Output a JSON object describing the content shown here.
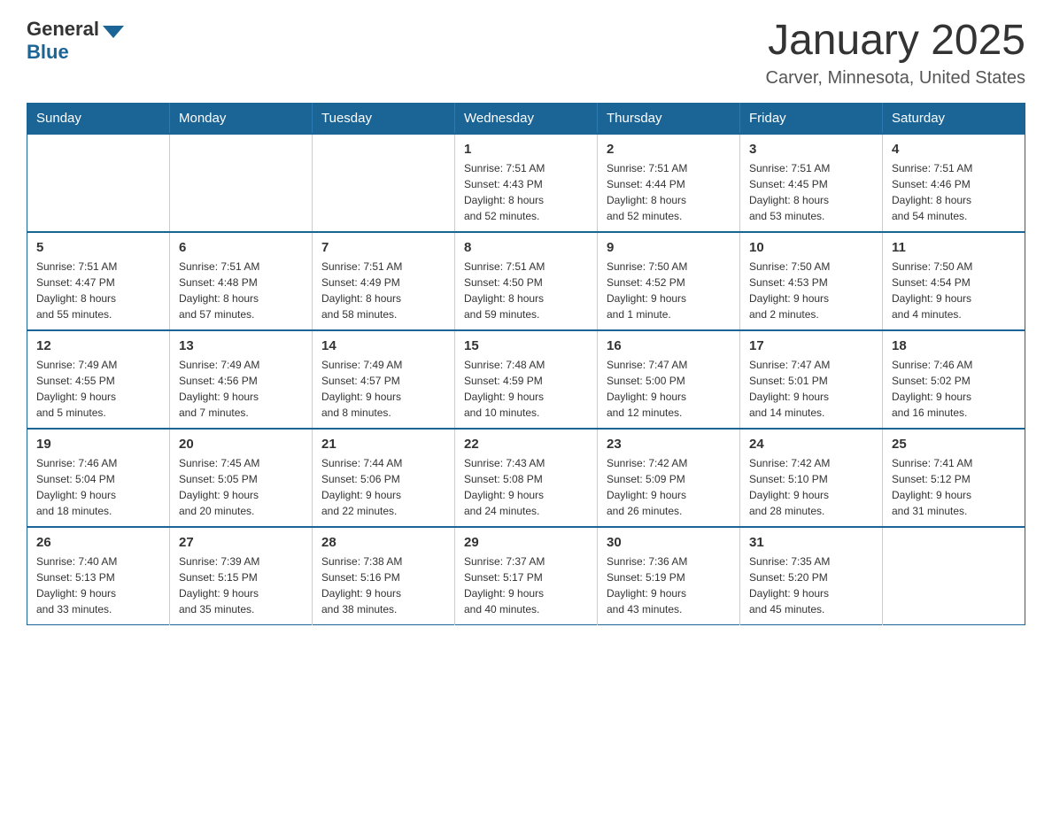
{
  "logo": {
    "general": "General",
    "blue": "Blue"
  },
  "title": "January 2025",
  "subtitle": "Carver, Minnesota, United States",
  "days_of_week": [
    "Sunday",
    "Monday",
    "Tuesday",
    "Wednesday",
    "Thursday",
    "Friday",
    "Saturday"
  ],
  "weeks": [
    [
      {
        "day": "",
        "info": ""
      },
      {
        "day": "",
        "info": ""
      },
      {
        "day": "",
        "info": ""
      },
      {
        "day": "1",
        "info": "Sunrise: 7:51 AM\nSunset: 4:43 PM\nDaylight: 8 hours\nand 52 minutes."
      },
      {
        "day": "2",
        "info": "Sunrise: 7:51 AM\nSunset: 4:44 PM\nDaylight: 8 hours\nand 52 minutes."
      },
      {
        "day": "3",
        "info": "Sunrise: 7:51 AM\nSunset: 4:45 PM\nDaylight: 8 hours\nand 53 minutes."
      },
      {
        "day": "4",
        "info": "Sunrise: 7:51 AM\nSunset: 4:46 PM\nDaylight: 8 hours\nand 54 minutes."
      }
    ],
    [
      {
        "day": "5",
        "info": "Sunrise: 7:51 AM\nSunset: 4:47 PM\nDaylight: 8 hours\nand 55 minutes."
      },
      {
        "day": "6",
        "info": "Sunrise: 7:51 AM\nSunset: 4:48 PM\nDaylight: 8 hours\nand 57 minutes."
      },
      {
        "day": "7",
        "info": "Sunrise: 7:51 AM\nSunset: 4:49 PM\nDaylight: 8 hours\nand 58 minutes."
      },
      {
        "day": "8",
        "info": "Sunrise: 7:51 AM\nSunset: 4:50 PM\nDaylight: 8 hours\nand 59 minutes."
      },
      {
        "day": "9",
        "info": "Sunrise: 7:50 AM\nSunset: 4:52 PM\nDaylight: 9 hours\nand 1 minute."
      },
      {
        "day": "10",
        "info": "Sunrise: 7:50 AM\nSunset: 4:53 PM\nDaylight: 9 hours\nand 2 minutes."
      },
      {
        "day": "11",
        "info": "Sunrise: 7:50 AM\nSunset: 4:54 PM\nDaylight: 9 hours\nand 4 minutes."
      }
    ],
    [
      {
        "day": "12",
        "info": "Sunrise: 7:49 AM\nSunset: 4:55 PM\nDaylight: 9 hours\nand 5 minutes."
      },
      {
        "day": "13",
        "info": "Sunrise: 7:49 AM\nSunset: 4:56 PM\nDaylight: 9 hours\nand 7 minutes."
      },
      {
        "day": "14",
        "info": "Sunrise: 7:49 AM\nSunset: 4:57 PM\nDaylight: 9 hours\nand 8 minutes."
      },
      {
        "day": "15",
        "info": "Sunrise: 7:48 AM\nSunset: 4:59 PM\nDaylight: 9 hours\nand 10 minutes."
      },
      {
        "day": "16",
        "info": "Sunrise: 7:47 AM\nSunset: 5:00 PM\nDaylight: 9 hours\nand 12 minutes."
      },
      {
        "day": "17",
        "info": "Sunrise: 7:47 AM\nSunset: 5:01 PM\nDaylight: 9 hours\nand 14 minutes."
      },
      {
        "day": "18",
        "info": "Sunrise: 7:46 AM\nSunset: 5:02 PM\nDaylight: 9 hours\nand 16 minutes."
      }
    ],
    [
      {
        "day": "19",
        "info": "Sunrise: 7:46 AM\nSunset: 5:04 PM\nDaylight: 9 hours\nand 18 minutes."
      },
      {
        "day": "20",
        "info": "Sunrise: 7:45 AM\nSunset: 5:05 PM\nDaylight: 9 hours\nand 20 minutes."
      },
      {
        "day": "21",
        "info": "Sunrise: 7:44 AM\nSunset: 5:06 PM\nDaylight: 9 hours\nand 22 minutes."
      },
      {
        "day": "22",
        "info": "Sunrise: 7:43 AM\nSunset: 5:08 PM\nDaylight: 9 hours\nand 24 minutes."
      },
      {
        "day": "23",
        "info": "Sunrise: 7:42 AM\nSunset: 5:09 PM\nDaylight: 9 hours\nand 26 minutes."
      },
      {
        "day": "24",
        "info": "Sunrise: 7:42 AM\nSunset: 5:10 PM\nDaylight: 9 hours\nand 28 minutes."
      },
      {
        "day": "25",
        "info": "Sunrise: 7:41 AM\nSunset: 5:12 PM\nDaylight: 9 hours\nand 31 minutes."
      }
    ],
    [
      {
        "day": "26",
        "info": "Sunrise: 7:40 AM\nSunset: 5:13 PM\nDaylight: 9 hours\nand 33 minutes."
      },
      {
        "day": "27",
        "info": "Sunrise: 7:39 AM\nSunset: 5:15 PM\nDaylight: 9 hours\nand 35 minutes."
      },
      {
        "day": "28",
        "info": "Sunrise: 7:38 AM\nSunset: 5:16 PM\nDaylight: 9 hours\nand 38 minutes."
      },
      {
        "day": "29",
        "info": "Sunrise: 7:37 AM\nSunset: 5:17 PM\nDaylight: 9 hours\nand 40 minutes."
      },
      {
        "day": "30",
        "info": "Sunrise: 7:36 AM\nSunset: 5:19 PM\nDaylight: 9 hours\nand 43 minutes."
      },
      {
        "day": "31",
        "info": "Sunrise: 7:35 AM\nSunset: 5:20 PM\nDaylight: 9 hours\nand 45 minutes."
      },
      {
        "day": "",
        "info": ""
      }
    ]
  ]
}
